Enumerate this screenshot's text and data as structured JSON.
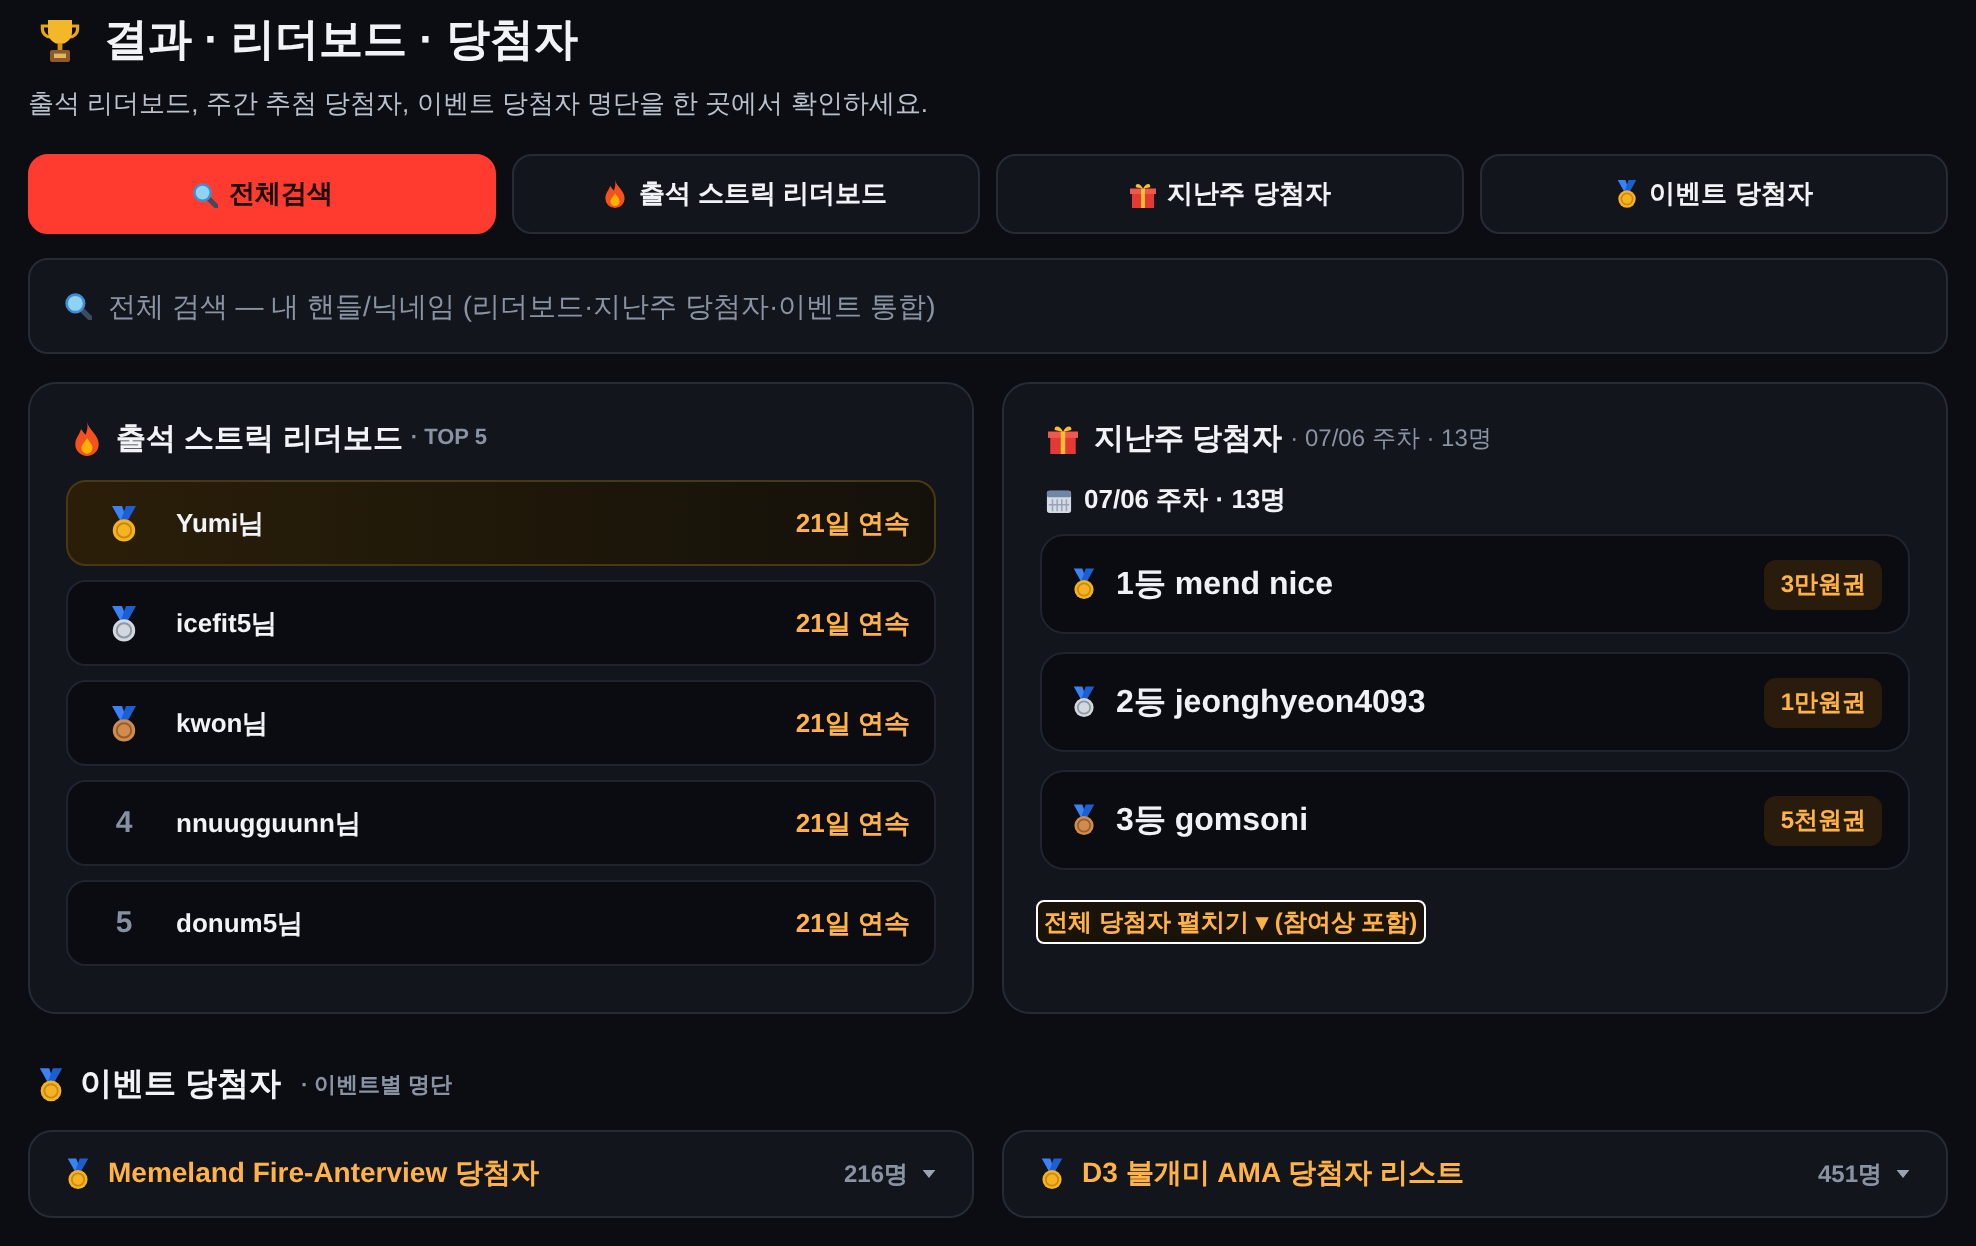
{
  "header": {
    "title": "결과 · 리더보드 · 당첨자",
    "subtitle": "출석 리더보드, 주간 추첨 당첨자, 이벤트 당첨자 명단을 한 곳에서 확인하세요."
  },
  "tabs": [
    {
      "kind": "search",
      "label": "전체검색",
      "selected": true
    },
    {
      "kind": "streak",
      "label": "출석 스트릭 리더보드",
      "selected": false
    },
    {
      "kind": "weekly",
      "label": "지난주 당첨자",
      "selected": false
    },
    {
      "kind": "event",
      "label": "이벤트 당첨자",
      "selected": false
    }
  ],
  "search": {
    "placeholder": "전체 검색 — 내 핸들/닉네임 (리더보드·지난주 당첨자·이벤트 통합)"
  },
  "leaderboard": {
    "title": "출석 스트릭 리더보드",
    "note": "· TOP 5",
    "rows": [
      {
        "kind": "gold",
        "name": "Yumi님",
        "streak": "21일 연속",
        "highlighted": true
      },
      {
        "kind": "silver",
        "name": "icefit5님",
        "streak": "21일 연속",
        "highlighted": false
      },
      {
        "kind": "bronze",
        "name": "kwon님",
        "streak": "21일 연속",
        "highlighted": false
      },
      {
        "kind": "number",
        "rank": "4",
        "name": "nnuugguunn님",
        "streak": "21일 연속",
        "highlighted": false
      },
      {
        "kind": "number",
        "rank": "5",
        "name": "donum5님",
        "streak": "21일 연속",
        "highlighted": false
      }
    ]
  },
  "weekly": {
    "title": "지난주 당첨자",
    "note": "· 07/06 주차 · 13명",
    "week": "07/06 주차 · 13명",
    "winners": [
      {
        "kind": "gold",
        "label": "1등 mend nice",
        "prize": "3만원권"
      },
      {
        "kind": "silver",
        "label": "2등 jeonghyeon4093",
        "prize": "1만원권"
      },
      {
        "kind": "bronze",
        "label": "3등 gomsoni",
        "prize": "5천원권"
      }
    ],
    "expand_button": {
      "label": "전체 당첨자 펼치기 ▾ (참여상 포함)",
      "focused": true
    }
  },
  "events": {
    "title": "이벤트 당첨자",
    "note": "· 이벤트별 명단",
    "items": [
      {
        "name": "Memeland Fire-Anterview 당첨자",
        "count": "216명",
        "expanded": false
      },
      {
        "name": "D3 불개미 AMA 당첨자 리스트",
        "count": "451명",
        "expanded": false
      }
    ]
  }
}
